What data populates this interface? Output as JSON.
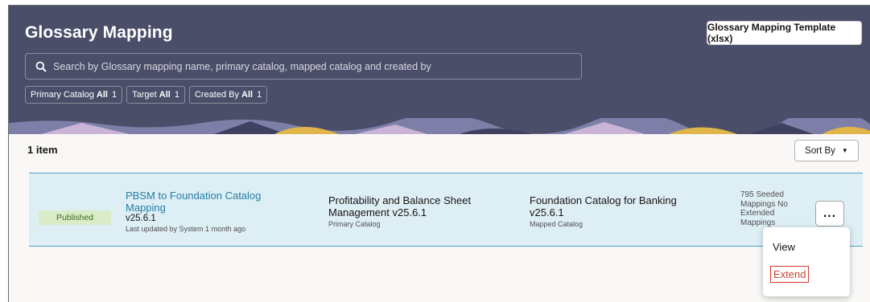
{
  "header": {
    "title": "Glossary Mapping",
    "template_button": "Glossary Mapping Template (xlsx)",
    "search_placeholder": "Search by Glossary mapping name, primary catalog, mapped catalog and created by",
    "filters": [
      {
        "label": "Primary Catalog",
        "value": "All",
        "count": "1"
      },
      {
        "label": "Target",
        "value": "All",
        "count": "1"
      },
      {
        "label": "Created By",
        "value": "All",
        "count": "1"
      }
    ]
  },
  "list": {
    "item_count": "1 item",
    "sort_label": "Sort By"
  },
  "row": {
    "status": "Published",
    "name": "PBSM to Foundation Catalog Mapping",
    "version": "v25.6.1",
    "updated": "Last updated by System 1 month ago",
    "primary_catalog": "Profitability and Balance Sheet Management v25.6.1",
    "primary_catalog_label": "Primary Catalog",
    "mapped_catalog": "Foundation Catalog for Banking v25.6.1",
    "mapped_catalog_label": "Mapped Catalog",
    "stats": "795 Seeded Mappings No Extended Mappings",
    "more_label": "..."
  },
  "menu": {
    "view": "View",
    "extend": "Extend"
  },
  "colors": {
    "header_bg": "#4b4e69",
    "row_bg": "#deeef5",
    "link": "#227ea6",
    "published_badge": "#d9ecc7",
    "extend_highlight": "#d9362b"
  },
  "icons": [
    "search-icon",
    "caret-down-icon",
    "more-icon"
  ]
}
